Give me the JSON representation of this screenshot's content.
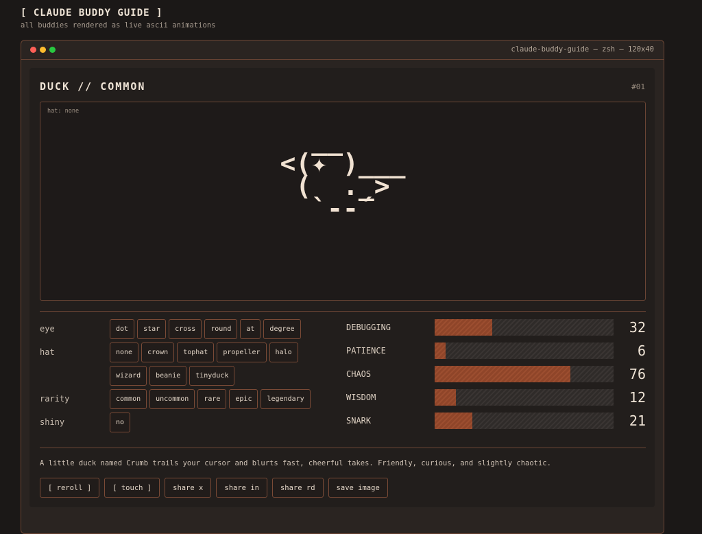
{
  "header": {
    "title": "[ CLAUDE BUDDY GUIDE ]",
    "subtitle": "all buddies rendered as live ascii animations"
  },
  "window": {
    "title": "claude-buddy-guide — zsh — 120x40"
  },
  "buddy": {
    "name": "DUCK // COMMON",
    "number": "#01",
    "hat_label": "hat: none",
    "ascii": "  __\n<(✦ )___\n (  ._>\n  `--´"
  },
  "options": [
    {
      "label": "eye",
      "chips": [
        "dot",
        "star",
        "cross",
        "round",
        "at",
        "degree"
      ]
    },
    {
      "label": "hat",
      "chips": [
        "none",
        "crown",
        "tophat",
        "propeller",
        "halo",
        "wizard",
        "beanie",
        "tinyduck"
      ]
    },
    {
      "label": "rarity",
      "chips": [
        "common",
        "uncommon",
        "rare",
        "epic",
        "legendary"
      ]
    },
    {
      "label": "shiny",
      "chips": [
        "no"
      ]
    }
  ],
  "stats": [
    {
      "label": "DEBUGGING",
      "value": 32
    },
    {
      "label": "PATIENCE",
      "value": 6
    },
    {
      "label": "CHAOS",
      "value": 76
    },
    {
      "label": "WISDOM",
      "value": 12
    },
    {
      "label": "SNARK",
      "value": 21
    }
  ],
  "description": "A little duck named Crumb trails your cursor and blurts fast, cheerful takes. Friendly, curious, and slightly chaotic.",
  "buttons": [
    "[ reroll ]",
    "[ touch ]",
    "share x",
    "share in",
    "share rd",
    "save image"
  ]
}
